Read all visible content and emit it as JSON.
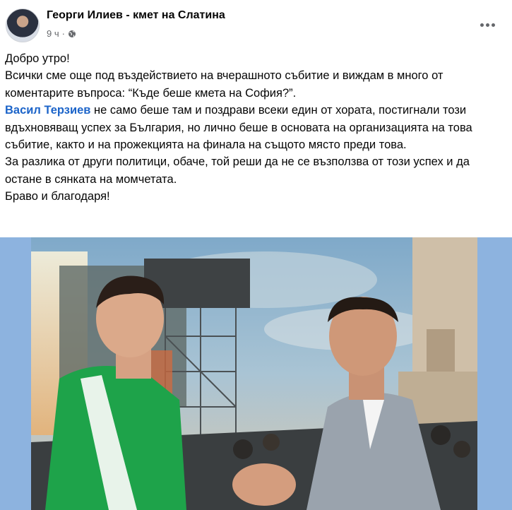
{
  "post": {
    "author": "Георги Илиев - кмет на Слатина",
    "time": "9 ч",
    "dot": "·",
    "privacy_icon": "globe-icon",
    "more_icon": "more-options-icon",
    "body": {
      "line1": "Добро утро!",
      "line2": "Всички сме още под въздействието на вчерашното събитие и виждам в много от коментарите въпроса: “Къде беше кмета на София?”.",
      "mention": "Васил Терзиев",
      "line3_rest": " не само беше там и поздрави всеки един от хората, постигнали този вдъхновяващ успех за България, но лично беше в основата на организацията на това събитие, както и на прожекцията на финала на същото място преди това.",
      "line4": "За разлика от други политици, обаче, той реши да не се възползва от този успех и да остане в сянката на момчетата.",
      "line5": "Браво и благодаря!"
    }
  },
  "colors": {
    "mention": "#1c64c9",
    "media_background": "#8db3df",
    "jersey": "#1ea34a",
    "jacket": "#9aa3ad"
  }
}
